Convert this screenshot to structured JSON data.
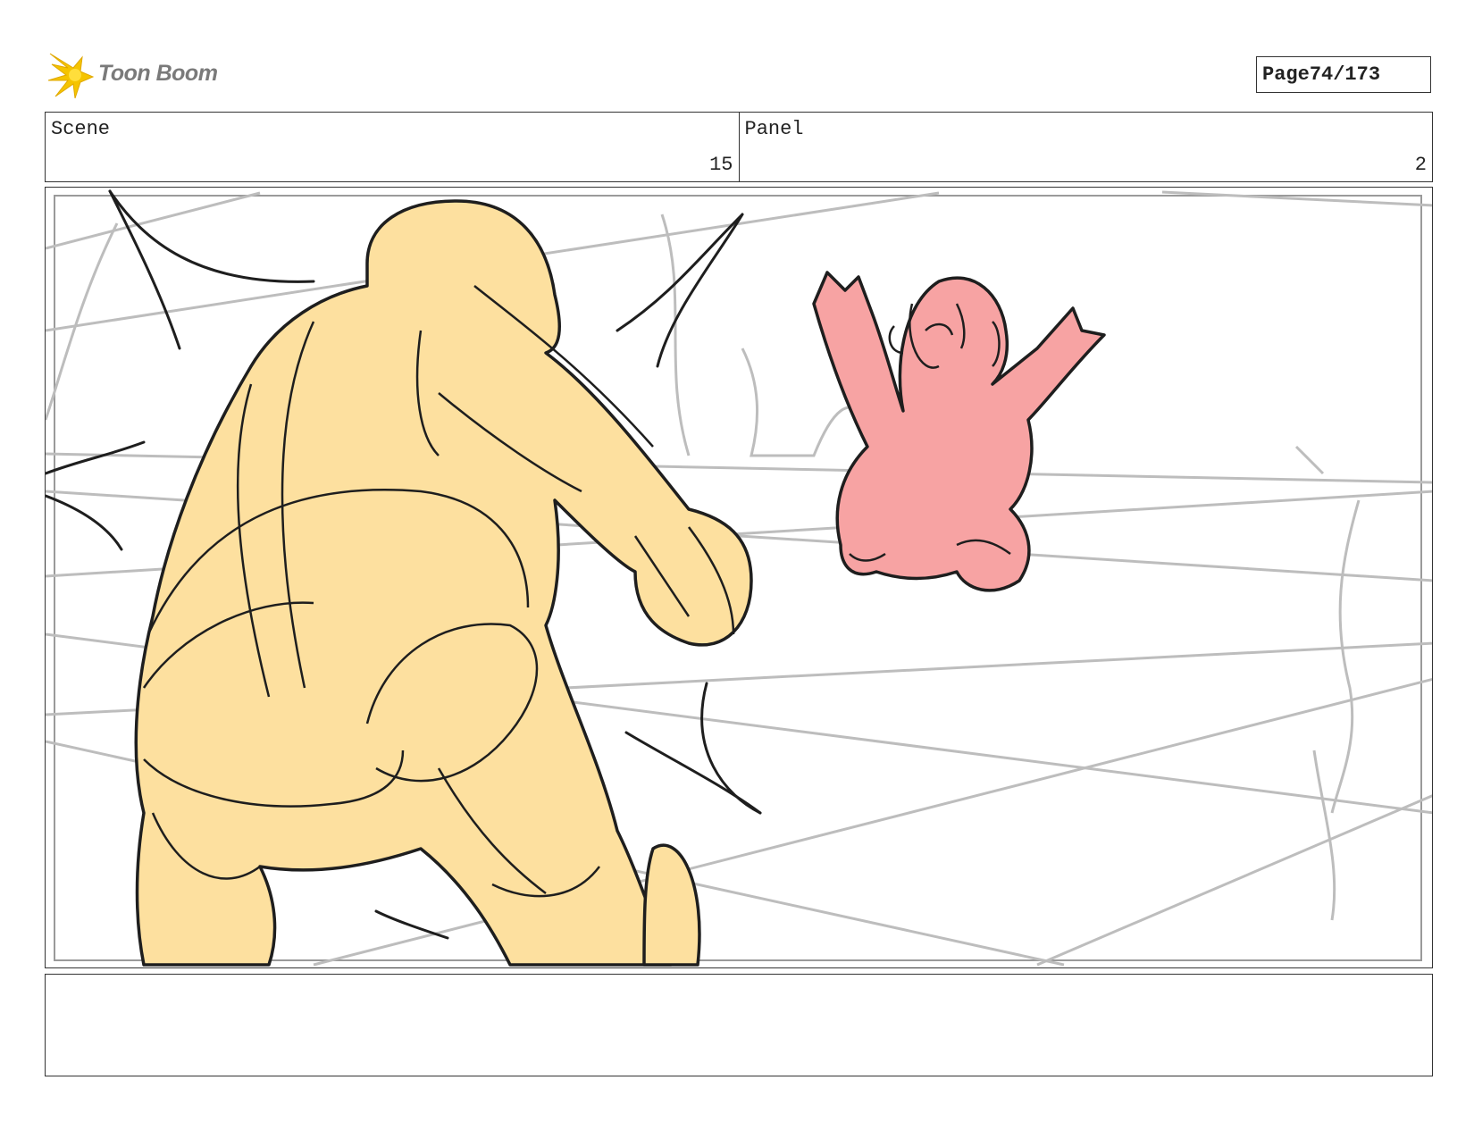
{
  "brand": {
    "logo_text": "Toon Boom",
    "accent_color": "#f5c400"
  },
  "page": {
    "label": "Page",
    "number": "74/173"
  },
  "scene": {
    "label": "Scene",
    "value": "15"
  },
  "panel": {
    "label": "Panel",
    "value": "2"
  },
  "artwork": {
    "colors": {
      "figure_fill": "#fde09f",
      "creature_fill": "#f7a3a3",
      "ink": "#1e1e1e",
      "perspective_lines": "#bdbdbd"
    },
    "icons": [
      "toon-boom-logo-icon"
    ]
  },
  "notes": {
    "text": ""
  }
}
